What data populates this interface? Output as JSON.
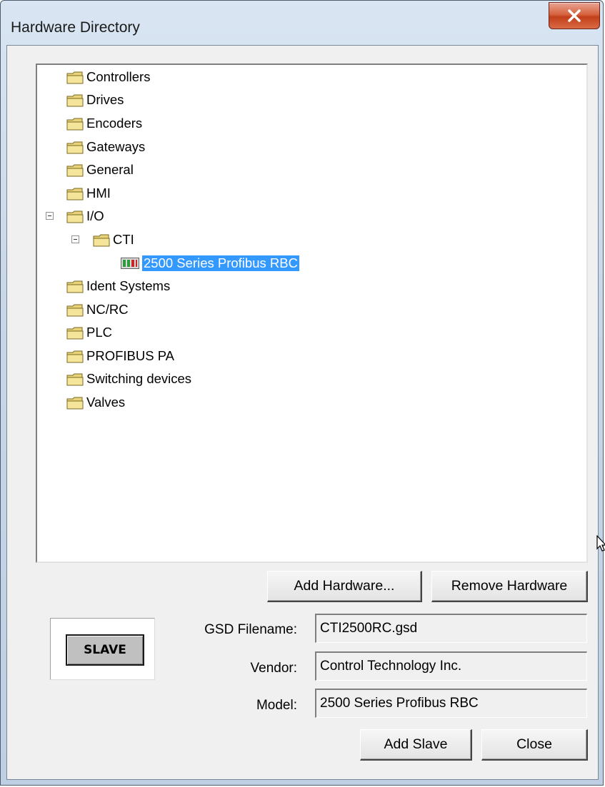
{
  "window": {
    "title": "Hardware Directory"
  },
  "titlebar": {
    "close_icon": "close-x-icon"
  },
  "tree": {
    "items": [
      {
        "label": "Controllers",
        "icon": "folder-icon",
        "expanded": false
      },
      {
        "label": "Drives",
        "icon": "folder-icon",
        "expanded": false
      },
      {
        "label": "Encoders",
        "icon": "folder-icon",
        "expanded": false
      },
      {
        "label": "Gateways",
        "icon": "folder-icon",
        "expanded": false
      },
      {
        "label": "General",
        "icon": "folder-icon",
        "expanded": false
      },
      {
        "label": "HMI",
        "icon": "folder-icon",
        "expanded": false
      },
      {
        "label": "I/O",
        "icon": "folder-icon",
        "expanded": true
      },
      {
        "label": "CTI",
        "icon": "folder-icon",
        "expanded": true
      },
      {
        "label": "2500 Series Profibus RBC",
        "icon": "device-icon",
        "selected": true
      },
      {
        "label": "Ident Systems",
        "icon": "folder-icon",
        "expanded": false
      },
      {
        "label": "NC/RC",
        "icon": "folder-icon",
        "expanded": false
      },
      {
        "label": "PLC",
        "icon": "folder-icon",
        "expanded": false
      },
      {
        "label": "PROFIBUS PA",
        "icon": "folder-icon",
        "expanded": false
      },
      {
        "label": "Switching devices",
        "icon": "folder-icon",
        "expanded": false
      },
      {
        "label": "Valves",
        "icon": "folder-icon",
        "expanded": false
      }
    ]
  },
  "buttons": {
    "add_hardware": "Add Hardware...",
    "remove_hardware": "Remove Hardware",
    "add_slave": "Add Slave",
    "close": "Close"
  },
  "slave": {
    "label": "SLAVE"
  },
  "details": {
    "gsd_label": "GSD Filename:",
    "gsd_value": "CTI2500RC.gsd",
    "vendor_label": "Vendor:",
    "vendor_value": "Control Technology Inc.",
    "model_label": "Model:",
    "model_value": "2500 Series Profibus RBC"
  },
  "colors": {
    "selection": "#3399ff",
    "folder": "#e8d27a",
    "close_button": "#c9502c"
  }
}
